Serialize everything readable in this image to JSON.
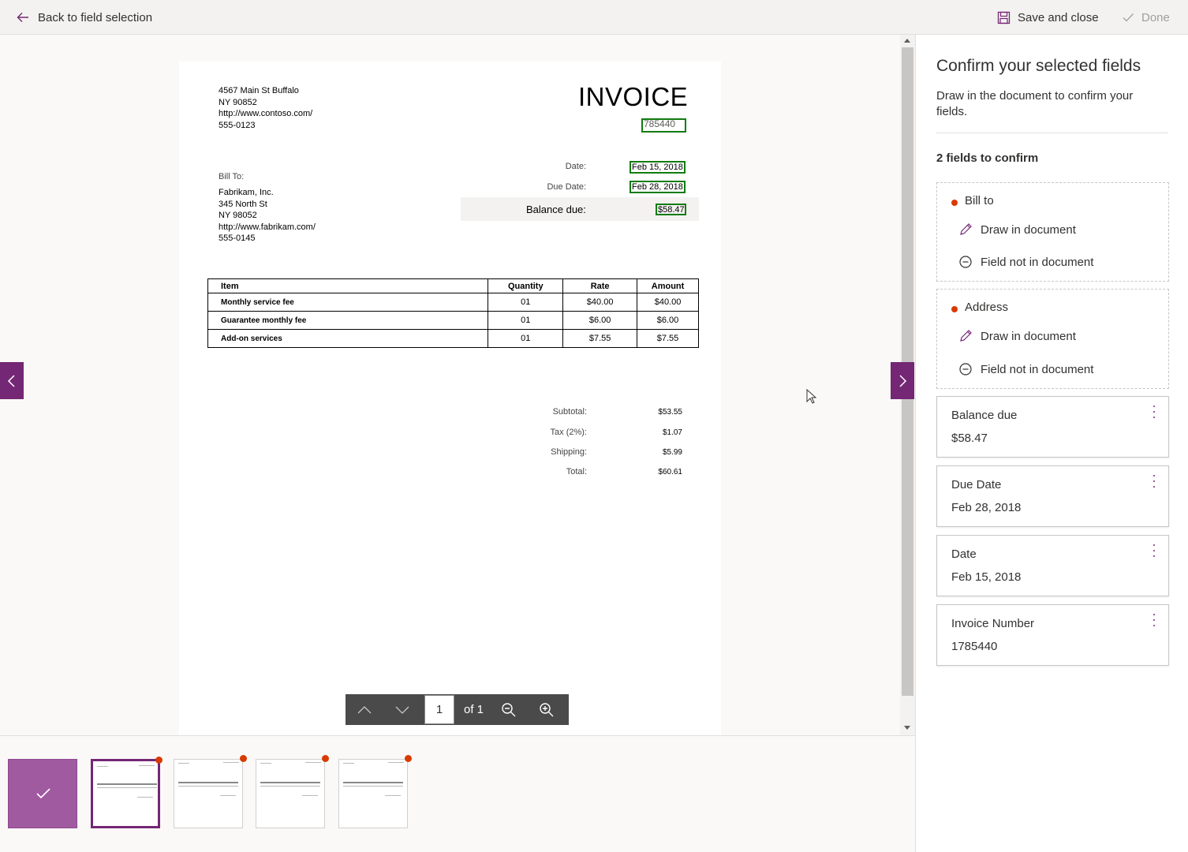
{
  "topbar": {
    "back_label": "Back to field selection",
    "save_label": "Save and close",
    "done_label": "Done"
  },
  "invoice": {
    "address_lines": [
      "4567 Main St Buffalo",
      "NY 90852",
      "http://www.contoso.com/",
      "555-0123"
    ],
    "title": "INVOICE",
    "number": "785440",
    "date_label": "Date:",
    "date_value": "Feb 15, 2018",
    "due_label": "Due Date:",
    "due_value": "Feb 28, 2018",
    "balance_label": "Balance due:",
    "balance_value": "$58.47",
    "billto_label": "Bill To:",
    "billto_lines": [
      "Fabrikam, Inc.",
      "345 North St",
      "NY 98052",
      "http://www.fabrikam.com/",
      "555-0145"
    ],
    "table": {
      "headers": [
        "Item",
        "Quantity",
        "Rate",
        "Amount"
      ],
      "rows": [
        [
          "Monthly service fee",
          "01",
          "$40.00",
          "$40.00"
        ],
        [
          "Guarantee monthly fee",
          "01",
          "$6.00",
          "$6.00"
        ],
        [
          "Add-on services",
          "01",
          "$7.55",
          "$7.55"
        ]
      ]
    },
    "totals": [
      {
        "label": "Subtotal:",
        "value": "$53.55"
      },
      {
        "label": "Tax (2%):",
        "value": "$1.07"
      },
      {
        "label": "Shipping:",
        "value": "$5.99"
      },
      {
        "label": "Total:",
        "value": "$60.61"
      }
    ]
  },
  "pager": {
    "page_value": "1",
    "of_label": "of 1"
  },
  "panel": {
    "title": "Confirm your selected fields",
    "subtitle": "Draw in the document to confirm your fields.",
    "count_label": "2 fields to confirm",
    "unconfirmed": [
      {
        "name": "Bill to",
        "draw_label": "Draw in document",
        "missing_label": "Field not in document"
      },
      {
        "name": "Address",
        "draw_label": "Draw in document",
        "missing_label": "Field not in document"
      }
    ],
    "confirmed": [
      {
        "name": "Balance due",
        "value": "$58.47"
      },
      {
        "name": "Due Date",
        "value": "Feb 28, 2018"
      },
      {
        "name": "Date",
        "value": "Feb 15, 2018"
      },
      {
        "name": "Invoice Number",
        "value": "1785440"
      }
    ]
  },
  "colors": {
    "accent": "#742774",
    "field_box": "#107c10",
    "required_dot": "#d83b01"
  },
  "icons": {
    "back": "arrow-left-icon",
    "save": "save-icon",
    "done": "checkmark-icon",
    "draw": "pencil-icon",
    "missing": "minus-circle-icon",
    "more": "more-vertical-icon"
  }
}
